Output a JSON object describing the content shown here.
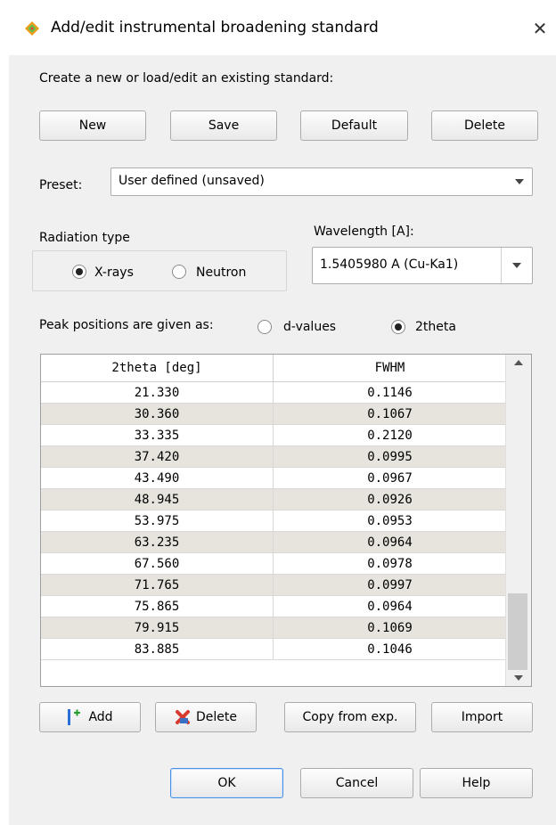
{
  "window": {
    "title": "Add/edit instrumental broadening standard",
    "close_glyph": "✕"
  },
  "intro_label": "Create a new or load/edit an existing standard:",
  "top_buttons": {
    "new": "New",
    "save": "Save",
    "default": "Default",
    "delete": "Delete"
  },
  "preset": {
    "label": "Preset:",
    "value": "User defined (unsaved)"
  },
  "radiation": {
    "label": "Radiation type",
    "xrays": "X-rays",
    "neutron": "Neutron",
    "selected": "X-rays"
  },
  "wavelength": {
    "label": "Wavelength [A]:",
    "value": "1.5405980 A (Cu-Ka1)"
  },
  "peak_positions": {
    "label": "Peak positions are given as:",
    "dvalues": "d-values",
    "twotheta": "2theta",
    "selected": "2theta"
  },
  "table": {
    "headers": [
      "2theta [deg]",
      "FWHM"
    ],
    "rows": [
      [
        "21.330",
        "0.1146"
      ],
      [
        "30.360",
        "0.1067"
      ],
      [
        "33.335",
        "0.2120"
      ],
      [
        "37.420",
        "0.0995"
      ],
      [
        "43.490",
        "0.0967"
      ],
      [
        "48.945",
        "0.0926"
      ],
      [
        "53.975",
        "0.0953"
      ],
      [
        "63.235",
        "0.0964"
      ],
      [
        "67.560",
        "0.0978"
      ],
      [
        "71.765",
        "0.0997"
      ],
      [
        "75.865",
        "0.0964"
      ],
      [
        "79.915",
        "0.1069"
      ],
      [
        "83.885",
        "0.1046"
      ]
    ]
  },
  "bottom_buttons": {
    "add": "Add",
    "delete": "Delete",
    "copy": "Copy from exp.",
    "import": "Import"
  },
  "dialog_buttons": {
    "ok": "OK",
    "cancel": "Cancel",
    "help": "Help"
  },
  "colors": {
    "window_bg": "#f0f0f0",
    "alt_row": "#e6e4dc",
    "ok_border": "#4a90e2",
    "add_icon": "#2a6fd6",
    "delete_icon": "#d83a2e"
  }
}
